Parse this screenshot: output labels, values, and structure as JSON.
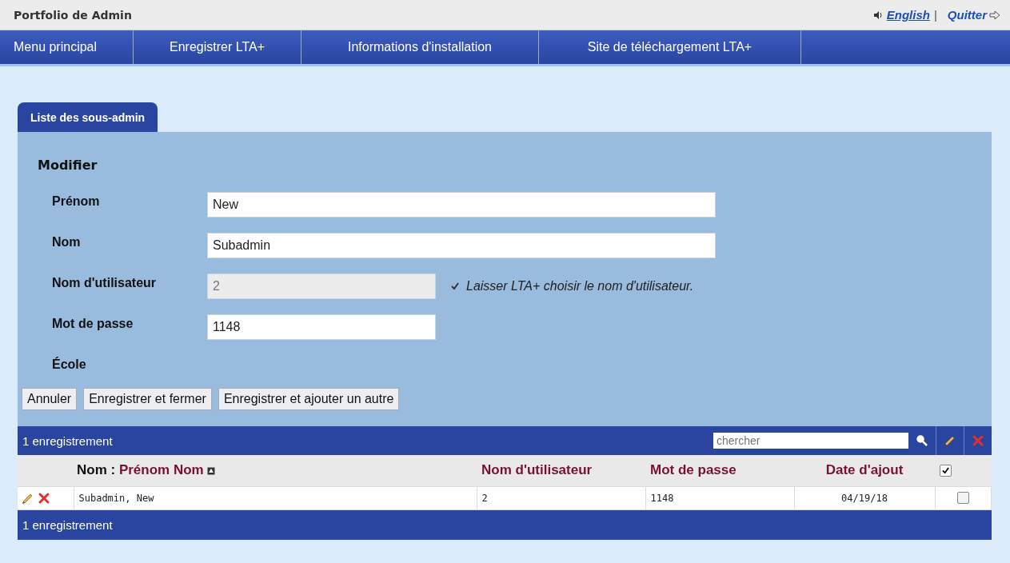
{
  "header": {
    "title": "Portfolio de Admin",
    "language_link": "English",
    "separator": "|",
    "quit_link": "Quitter"
  },
  "nav": {
    "items": [
      {
        "label": "Menu principal"
      },
      {
        "label": "Enregistrer LTA+"
      },
      {
        "label": "Informations d'installation"
      },
      {
        "label": "Site de téléchargement LTA+"
      }
    ]
  },
  "tabs": [
    {
      "label": "Liste des sous-admin",
      "selected": true
    }
  ],
  "form": {
    "heading": "Modifier",
    "fields": [
      {
        "kind": "wide_text",
        "label": "Prénom",
        "value": "New",
        "disabled": false
      },
      {
        "kind": "wide_text",
        "label": "Nom",
        "value": "Subadmin",
        "disabled": false
      },
      {
        "kind": "text",
        "label": "Nom d'utilisateur",
        "value": "2",
        "disabled": true,
        "option": {
          "label": "Laisser LTA+ choisir le nom d'utilisateur.",
          "checked": true
        }
      },
      {
        "kind": "text",
        "label": "Mot de passe",
        "value": "1148",
        "disabled": false
      },
      {
        "kind": "label",
        "label": "École"
      }
    ],
    "buttons": [
      "Annuler",
      "Enregistrer et fermer",
      "Enregistrer et ajouter un autre"
    ]
  },
  "grid": {
    "count": "1 enregistrement",
    "search": {
      "placeholder": "chercher"
    },
    "columns": [
      {
        "prefix": "Nom :",
        "label": "Prénom Nom",
        "sortable": true
      },
      {
        "label": "Nom d'utilisateur"
      },
      {
        "label": "Mot de passe"
      },
      {
        "label": "Date d'ajout"
      }
    ],
    "select_all": {
      "checked": true
    },
    "rows": [
      {
        "cells": [
          "Subadmin, New",
          "2",
          "1148",
          "04/19/18"
        ],
        "checked": false
      }
    ],
    "footer": "1 enregistrement"
  }
}
